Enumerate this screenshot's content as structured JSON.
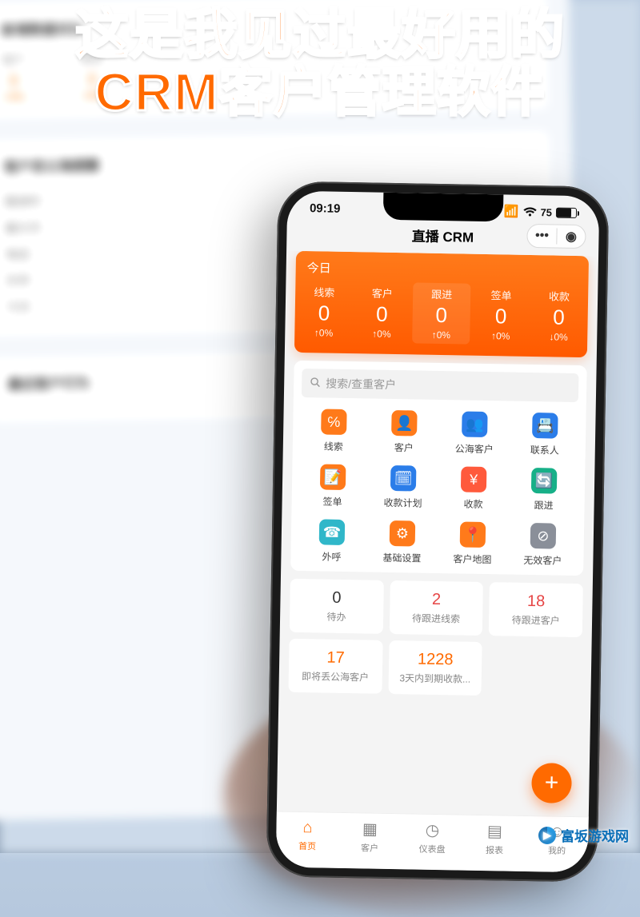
{
  "headline_l1": "这是我见过最好用的",
  "headline_l2": "CRM客户管理软件",
  "desktop": {
    "section1_title": "新增数据对比",
    "cols": [
      {
        "label": "客户",
        "num": "0",
        "pct": "+0%"
      },
      {
        "label": "跟进",
        "num": "0",
        "pct": "+0%"
      }
    ],
    "section2_title": "客户丢公海提醒",
    "list": [
      "跟进时",
      "最大天",
      "电话",
      "外呼",
      "今天"
    ],
    "section3_title": "最近客户行为"
  },
  "status": {
    "time": "09:19",
    "battery_text": "75"
  },
  "title": "直播 CRM",
  "today": {
    "header": "今日",
    "metrics": [
      {
        "label": "线索",
        "value": "0",
        "pct": "↑0%"
      },
      {
        "label": "客户",
        "value": "0",
        "pct": "↑0%"
      },
      {
        "label": "跟进",
        "value": "0",
        "pct": "↑0%"
      },
      {
        "label": "签单",
        "value": "0",
        "pct": "↑0%"
      },
      {
        "label": "收款",
        "value": "0",
        "pct": "↓0%"
      }
    ]
  },
  "search": {
    "placeholder": "搜索/查重客户"
  },
  "grid": [
    {
      "label": "线索",
      "bg": "#ff7a1a",
      "glyph": "℅"
    },
    {
      "label": "客户",
      "bg": "#ff7a1a",
      "glyph": "👤"
    },
    {
      "label": "公海客户",
      "bg": "#2b7de9",
      "glyph": "👥"
    },
    {
      "label": "联系人",
      "bg": "#2b7de9",
      "glyph": "📇"
    },
    {
      "label": "签单",
      "bg": "#ff7a1a",
      "glyph": "📝"
    },
    {
      "label": "收款计划",
      "bg": "#2b7de9",
      "glyph": "🗓"
    },
    {
      "label": "收款",
      "bg": "#ff5a3c",
      "glyph": "¥"
    },
    {
      "label": "跟进",
      "bg": "#17b088",
      "glyph": "🔄"
    },
    {
      "label": "外呼",
      "bg": "#30b7c9",
      "glyph": "☎"
    },
    {
      "label": "基础设置",
      "bg": "#ff7a1a",
      "glyph": "⚙"
    },
    {
      "label": "客户地图",
      "bg": "#ff7a1a",
      "glyph": "📍"
    },
    {
      "label": "无效客户",
      "bg": "#8a8f99",
      "glyph": "⊘"
    }
  ],
  "stats": [
    {
      "value": "0",
      "label": "待办",
      "cls": "c-black"
    },
    {
      "value": "2",
      "label": "待跟进线索",
      "cls": "c-red"
    },
    {
      "value": "18",
      "label": "待跟进客户",
      "cls": "c-red"
    },
    {
      "value": "17",
      "label": "即将丢公海客户",
      "cls": "c-orange"
    },
    {
      "value": "1228",
      "label": "3天内到期收款...",
      "cls": "c-orange"
    }
  ],
  "fab": "+",
  "tabs": [
    {
      "label": "首页",
      "icon": "⌂",
      "active": true
    },
    {
      "label": "客户",
      "icon": "▦",
      "active": false
    },
    {
      "label": "仪表盘",
      "icon": "◷",
      "active": false
    },
    {
      "label": "报表",
      "icon": "▤",
      "active": false
    },
    {
      "label": "我的",
      "icon": "☺",
      "active": false
    }
  ],
  "watermark": "富坂游戏网"
}
